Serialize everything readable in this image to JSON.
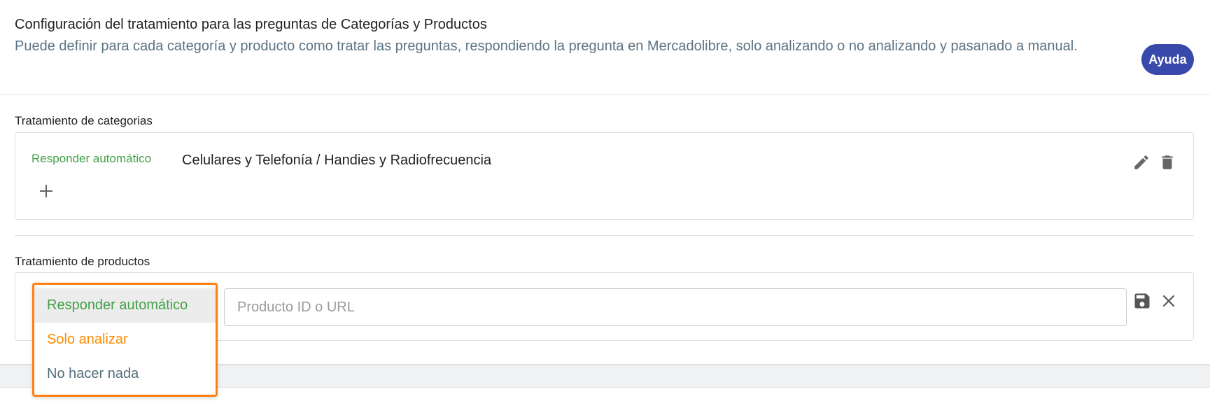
{
  "header": {
    "title": "Configuración del tratamiento para las preguntas de Categorías y Productos",
    "description": "Puede definir para cada categoría y producto como tratar las preguntas, respondiendo la pregunta en Mercadolibre, solo analizando o no analizando y pasanado a manual.",
    "help_label": "Ayuda"
  },
  "categories": {
    "label": "Tratamiento de categorias",
    "rows": [
      {
        "mode": "Responder automático",
        "name": "Celulares y Telefonía / Handies y Radiofrecuencia"
      }
    ]
  },
  "products": {
    "label": "Tratamiento de productos",
    "input_placeholder": "Producto ID o URL",
    "input_value": ""
  },
  "dropdown": {
    "options": [
      {
        "label": "Responder automático",
        "color": "#43a047",
        "selected": true
      },
      {
        "label": "Solo analizar",
        "color": "#fb8c00",
        "selected": false
      },
      {
        "label": "No hacer nada",
        "color": "#546e7a",
        "selected": false
      }
    ]
  },
  "colors": {
    "accent": "#3949ab",
    "auto_green": "#43a047",
    "analyze_orange": "#fb8c00",
    "highlight_border": "#ff7f0e"
  },
  "icons": {
    "edit": "pencil-icon",
    "delete": "trash-icon",
    "add": "plus-icon",
    "save": "floppy-disk-icon",
    "close": "close-icon"
  }
}
